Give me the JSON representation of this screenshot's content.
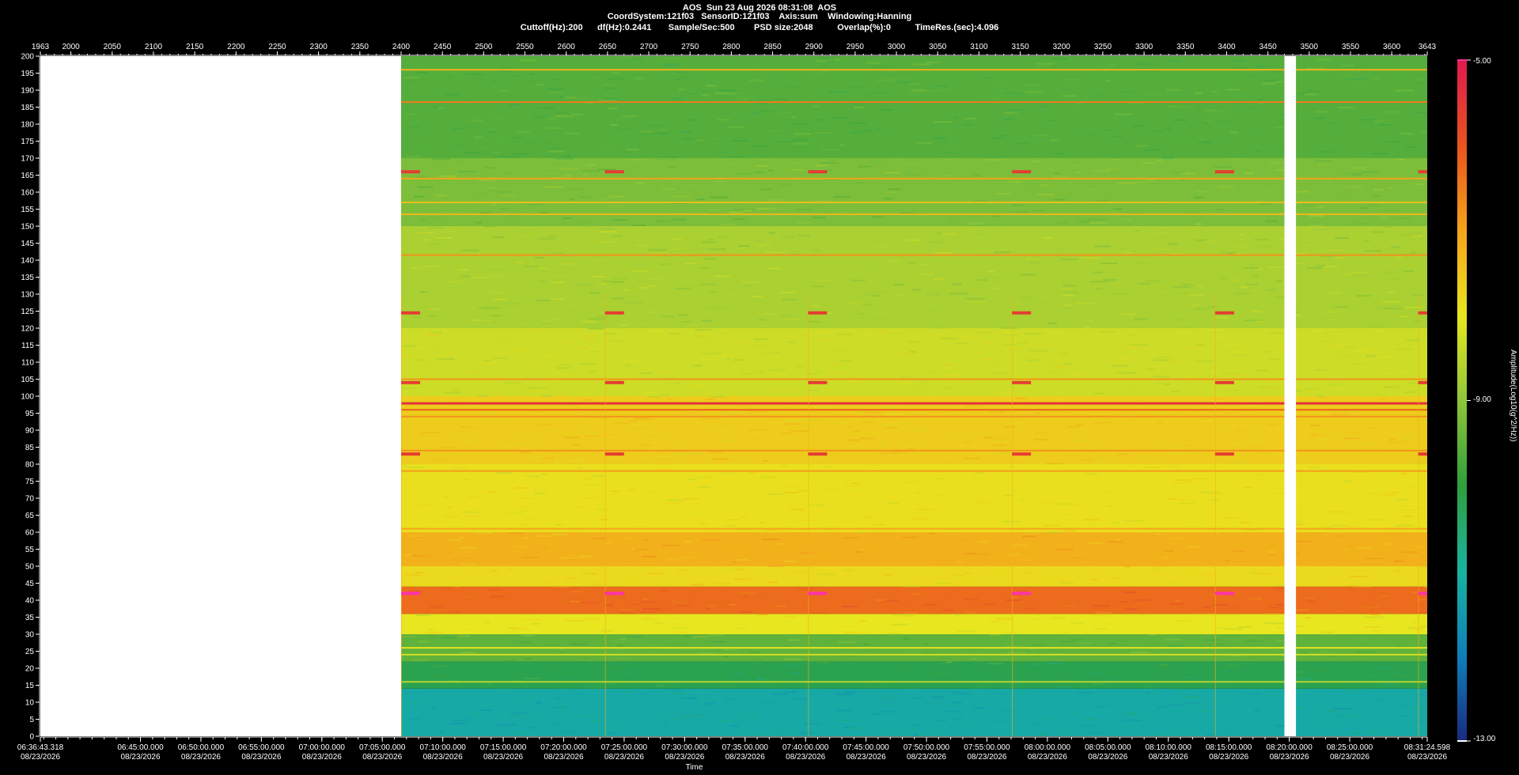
{
  "header": {
    "line1": "AOS  Sun 23 Aug 2026 08:31:08  AOS",
    "line2": "CoordSystem:121f03   SensorID:121f03    Axis:sum    Windowing:Hanning",
    "line3": "Cuttoff(Hz):200      df(Hz):0.2441       Sample/Sec:500        PSD size:2048          Overlap(%):0          TimeRes.(sec):4.096"
  },
  "colors": {
    "background": "#000000",
    "no_data": "#ffffff",
    "colormap": [
      "#1a2a80",
      "#0f7fb8",
      "#19b3a0",
      "#2f9e3c",
      "#8fc63a",
      "#e8e61e",
      "#f5a41a",
      "#e8531e",
      "#e01a4f"
    ]
  },
  "chart_data": {
    "type": "heatmap",
    "top_axis": {
      "ticks": [
        "1963",
        "2000",
        "2050",
        "2100",
        "2150",
        "2200",
        "2250",
        "2300",
        "2350",
        "2400",
        "2450",
        "2500",
        "2550",
        "2600",
        "2650",
        "2700",
        "2750",
        "2800",
        "2850",
        "2900",
        "2950",
        "3000",
        "3050",
        "3100",
        "3150",
        "3200",
        "3250",
        "3300",
        "3350",
        "3400",
        "3450",
        "3500",
        "3550",
        "3600",
        "3643"
      ],
      "range": [
        1963,
        3643
      ]
    },
    "y_axis": {
      "label": "",
      "range": [
        0,
        200
      ],
      "ticks": [
        200,
        195,
        190,
        185,
        180,
        175,
        170,
        165,
        160,
        155,
        150,
        145,
        140,
        135,
        130,
        125,
        120,
        115,
        110,
        105,
        100,
        95,
        90,
        85,
        80,
        75,
        70,
        65,
        60,
        55,
        50,
        45,
        40,
        35,
        30,
        25,
        20,
        15,
        10,
        5,
        0
      ]
    },
    "x_axis": {
      "label": "Time",
      "start": "06:36:43.318",
      "end": "08:31:24.598",
      "ticks": [
        {
          "time": "06:36:43.318",
          "date": "08/23/2026"
        },
        {
          "time": "06:45:00.000",
          "date": "08/23/2026"
        },
        {
          "time": "06:50:00.000",
          "date": "08/23/2026"
        },
        {
          "time": "06:55:00.000",
          "date": "08/23/2026"
        },
        {
          "time": "07:00:00.000",
          "date": "08/23/2026"
        },
        {
          "time": "07:05:00.000",
          "date": "08/23/2026"
        },
        {
          "time": "07:10:00.000",
          "date": "08/23/2026"
        },
        {
          "time": "07:15:00.000",
          "date": "08/23/2026"
        },
        {
          "time": "07:20:00.000",
          "date": "08/23/2026"
        },
        {
          "time": "07:25:00.000",
          "date": "08/23/2026"
        },
        {
          "time": "07:30:00.000",
          "date": "08/23/2026"
        },
        {
          "time": "07:35:00.000",
          "date": "08/23/2026"
        },
        {
          "time": "07:40:00.000",
          "date": "08/23/2026"
        },
        {
          "time": "07:45:00.000",
          "date": "08/23/2026"
        },
        {
          "time": "07:50:00.000",
          "date": "08/23/2026"
        },
        {
          "time": "07:55:00.000",
          "date": "08/23/2026"
        },
        {
          "time": "08:00:00.000",
          "date": "08/23/2026"
        },
        {
          "time": "08:05:00.000",
          "date": "08/23/2026"
        },
        {
          "time": "08:10:00.000",
          "date": "08/23/2026"
        },
        {
          "time": "08:15:00.000",
          "date": "08/23/2026"
        },
        {
          "time": "08:20:00.000",
          "date": "08/23/2026"
        },
        {
          "time": "08:25:00.000",
          "date": "08/23/2026"
        },
        {
          "time": "08:31:24.598",
          "date": "08/23/2026"
        }
      ]
    },
    "colorbar": {
      "label": "Amplitude(Log10(g^2/Hz))",
      "range": [
        -13,
        -5
      ],
      "ticks": [
        "-5.00",
        "-9.00",
        "-13.00"
      ]
    },
    "no_data_intervals_topaxis": [
      [
        1963,
        2400
      ],
      [
        3470,
        3484
      ]
    ],
    "horizontal_lines_hz": [
      {
        "hz": 196,
        "level": -7.2
      },
      {
        "hz": 186.5,
        "level": -6.5
      },
      {
        "hz": 164,
        "level": -7.0
      },
      {
        "hz": 157,
        "level": -7.4
      },
      {
        "hz": 153.5,
        "level": -7.3
      },
      {
        "hz": 141.5,
        "level": -6.8
      },
      {
        "hz": 105,
        "level": -6.8
      },
      {
        "hz": 98,
        "level": -5.4
      },
      {
        "hz": 96,
        "level": -6.2
      },
      {
        "hz": 94,
        "level": -6.8
      },
      {
        "hz": 84,
        "level": -6.8
      },
      {
        "hz": 78,
        "level": -6.9
      },
      {
        "hz": 61,
        "level": -7.0
      },
      {
        "hz": 26,
        "level": -8.0
      },
      {
        "hz": 24,
        "level": -8.2
      },
      {
        "hz": 16,
        "level": -8.6
      }
    ],
    "band_levels": [
      {
        "from": 0,
        "to": 14,
        "level": -11.2
      },
      {
        "from": 14,
        "to": 22,
        "level": -10.2
      },
      {
        "from": 22,
        "to": 30,
        "level": -9.5
      },
      {
        "from": 30,
        "to": 36,
        "level": -8.0
      },
      {
        "from": 36,
        "to": 44,
        "level": -6.3
      },
      {
        "from": 44,
        "to": 50,
        "level": -7.8
      },
      {
        "from": 50,
        "to": 60,
        "level": -7.2
      },
      {
        "from": 60,
        "to": 80,
        "level": -7.9
      },
      {
        "from": 80,
        "to": 100,
        "level": -7.6
      },
      {
        "from": 100,
        "to": 120,
        "level": -8.3
      },
      {
        "from": 120,
        "to": 150,
        "level": -8.7
      },
      {
        "from": 150,
        "to": 170,
        "level": -9.2
      },
      {
        "from": 170,
        "to": 200,
        "level": -9.6
      }
    ],
    "periodic_markers": {
      "topaxis_positions": [
        2400,
        2647,
        2893,
        3140,
        3386,
        3632
      ],
      "marker_hz": [
        124.5,
        83,
        42,
        166,
        104
      ]
    }
  }
}
